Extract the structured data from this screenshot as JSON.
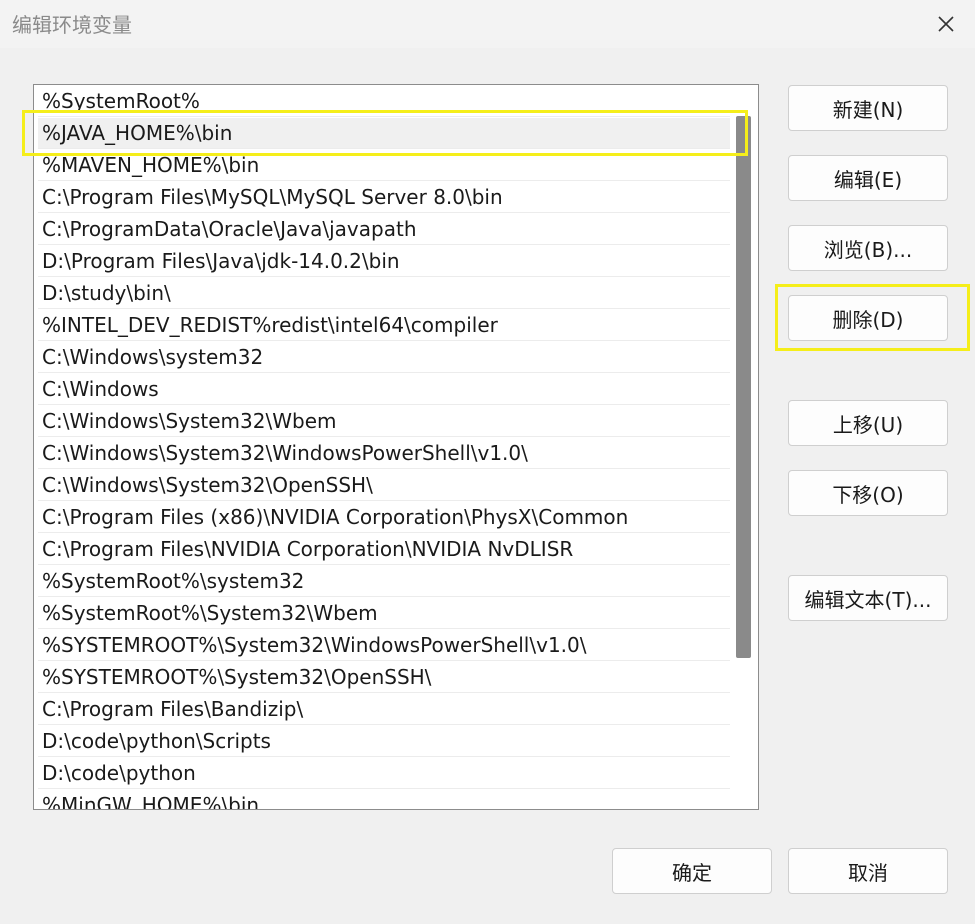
{
  "window": {
    "title": "编辑环境变量",
    "close_icon": "close-icon"
  },
  "list": {
    "selected_index": 1,
    "items": [
      "%SystemRoot%",
      "%JAVA_HOME%\\bin",
      "%MAVEN_HOME%\\bin",
      "C:\\Program Files\\MySQL\\MySQL Server 8.0\\bin",
      "C:\\ProgramData\\Oracle\\Java\\javapath",
      "D:\\Program Files\\Java\\jdk-14.0.2\\bin",
      "D:\\study\\bin\\",
      "%INTEL_DEV_REDIST%redist\\intel64\\compiler",
      "C:\\Windows\\system32",
      "C:\\Windows",
      "C:\\Windows\\System32\\Wbem",
      "C:\\Windows\\System32\\WindowsPowerShell\\v1.0\\",
      "C:\\Windows\\System32\\OpenSSH\\",
      "C:\\Program Files (x86)\\NVIDIA Corporation\\PhysX\\Common",
      "C:\\Program Files\\NVIDIA Corporation\\NVIDIA NvDLISR",
      "%SystemRoot%\\system32",
      "%SystemRoot%\\System32\\Wbem",
      "%SYSTEMROOT%\\System32\\WindowsPowerShell\\v1.0\\",
      "%SYSTEMROOT%\\System32\\OpenSSH\\",
      "C:\\Program Files\\Bandizip\\",
      "D:\\code\\python\\Scripts",
      "D:\\code\\python",
      "%MinGW_HOME%\\bin"
    ]
  },
  "buttons": {
    "new": "新建(N)",
    "edit": "编辑(E)",
    "browse": "浏览(B)...",
    "delete": "删除(D)",
    "move_up": "上移(U)",
    "move_down": "下移(O)",
    "edit_text": "编辑文本(T)...",
    "ok": "确定",
    "cancel": "取消"
  },
  "colors": {
    "highlight": "#f5ee1a",
    "selected_row": "#f0f0f0",
    "scrollbar": "#8a8a8a"
  }
}
